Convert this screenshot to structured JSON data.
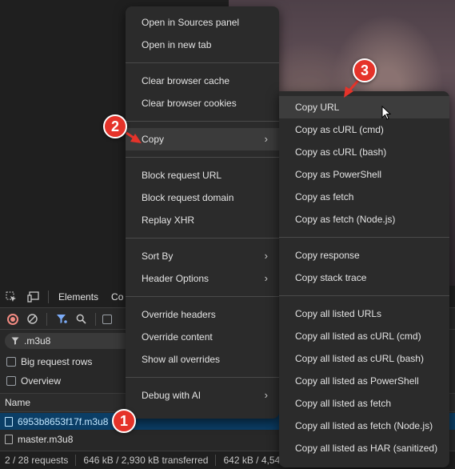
{
  "devtools": {
    "tabs": [
      "Elements",
      "Co"
    ],
    "filter_value": ".m3u8",
    "options": [
      {
        "label": "Big request rows"
      },
      {
        "label": "Overview"
      }
    ],
    "columns": {
      "name": "Name"
    },
    "rows": [
      {
        "name": "6953b8653f17f.m3u8",
        "selected": true
      },
      {
        "name": "master.m3u8",
        "selected": false
      }
    ],
    "status": {
      "requests": "2 / 28 requests",
      "transferred": "646 kB / 2,930 kB transferred",
      "resources": "642 kB / 4,54"
    }
  },
  "context_menu": {
    "groups": [
      [
        {
          "label": "Open in Sources panel"
        },
        {
          "label": "Open in new tab"
        }
      ],
      [
        {
          "label": "Clear browser cache"
        },
        {
          "label": "Clear browser cookies"
        }
      ],
      [
        {
          "label": "Copy",
          "has_submenu": true,
          "highlighted": true
        }
      ],
      [
        {
          "label": "Block request URL"
        },
        {
          "label": "Block request domain"
        },
        {
          "label": "Replay XHR"
        }
      ],
      [
        {
          "label": "Sort By",
          "has_submenu": true
        },
        {
          "label": "Header Options",
          "has_submenu": true
        }
      ],
      [
        {
          "label": "Override headers"
        },
        {
          "label": "Override content"
        },
        {
          "label": "Show all overrides"
        }
      ],
      [
        {
          "label": "Debug with AI",
          "has_submenu": true
        }
      ]
    ]
  },
  "copy_submenu": {
    "groups": [
      [
        {
          "label": "Copy URL",
          "highlighted": true
        },
        {
          "label": "Copy as cURL (cmd)"
        },
        {
          "label": "Copy as cURL (bash)"
        },
        {
          "label": "Copy as PowerShell"
        },
        {
          "label": "Copy as fetch"
        },
        {
          "label": "Copy as fetch (Node.js)"
        }
      ],
      [
        {
          "label": "Copy response"
        },
        {
          "label": "Copy stack trace"
        }
      ],
      [
        {
          "label": "Copy all listed URLs"
        },
        {
          "label": "Copy all listed as cURL (cmd)"
        },
        {
          "label": "Copy all listed as cURL (bash)"
        },
        {
          "label": "Copy all listed as PowerShell"
        },
        {
          "label": "Copy all listed as fetch"
        },
        {
          "label": "Copy all listed as fetch (Node.js)"
        },
        {
          "label": "Copy all listed as HAR (sanitized)"
        }
      ]
    ]
  },
  "annotations": {
    "badge_color": "#e5332a",
    "steps": [
      "1",
      "2",
      "3"
    ]
  }
}
